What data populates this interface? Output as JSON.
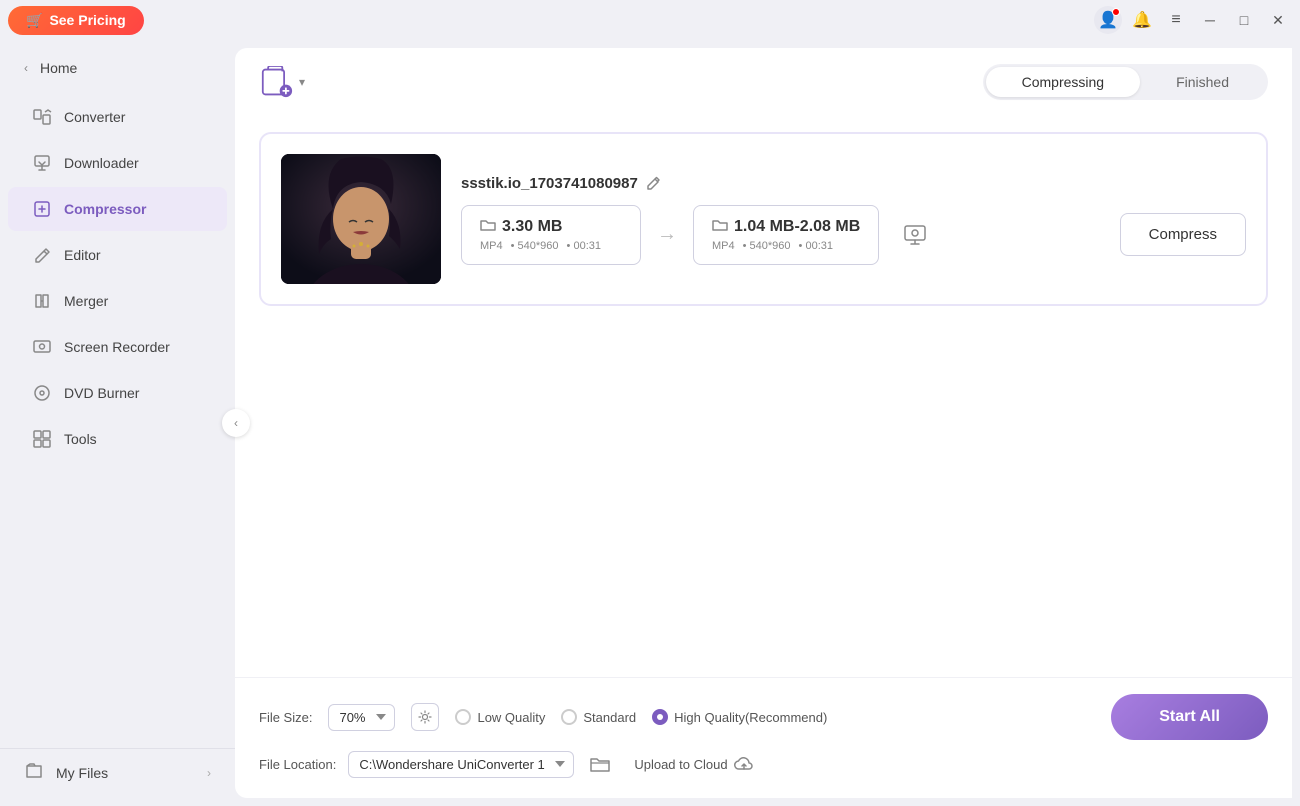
{
  "titlebar": {
    "see_pricing_label": "See Pricing",
    "cart_icon": "🛒"
  },
  "sidebar": {
    "home_label": "Home",
    "items": [
      {
        "id": "converter",
        "label": "Converter",
        "icon": "converter"
      },
      {
        "id": "downloader",
        "label": "Downloader",
        "icon": "downloader"
      },
      {
        "id": "compressor",
        "label": "Compressor",
        "icon": "compressor",
        "active": true
      },
      {
        "id": "editor",
        "label": "Editor",
        "icon": "editor"
      },
      {
        "id": "merger",
        "label": "Merger",
        "icon": "merger"
      },
      {
        "id": "screen-recorder",
        "label": "Screen Recorder",
        "icon": "screen-recorder"
      },
      {
        "id": "dvd-burner",
        "label": "DVD Burner",
        "icon": "dvd-burner"
      },
      {
        "id": "tools",
        "label": "Tools",
        "icon": "tools"
      }
    ],
    "my_files_label": "My Files"
  },
  "topbar": {
    "add_file_label": "Add File",
    "tabs": [
      {
        "id": "compressing",
        "label": "Compressing",
        "active": true
      },
      {
        "id": "finished",
        "label": "Finished",
        "active": false
      }
    ]
  },
  "file_card": {
    "filename": "ssstik.io_1703741080987",
    "original_size": "3.30 MB",
    "original_format": "MP4",
    "original_resolution": "540*960",
    "original_duration": "00:31",
    "target_size": "1.04 MB-2.08 MB",
    "target_format": "MP4",
    "target_resolution": "540*960",
    "target_duration": "00:31",
    "compress_btn_label": "Compress"
  },
  "bottom_bar": {
    "file_size_label": "File Size:",
    "file_size_value": "70%",
    "quality_options": [
      {
        "id": "low",
        "label": "Low Quality",
        "checked": false
      },
      {
        "id": "standard",
        "label": "Standard",
        "checked": false
      },
      {
        "id": "high",
        "label": "High Quality(Recommend)",
        "checked": true
      }
    ],
    "file_location_label": "File Location:",
    "file_location_value": "C:\\Wondershare UniConverter 1",
    "upload_to_cloud_label": "Upload to Cloud",
    "start_all_label": "Start All"
  }
}
